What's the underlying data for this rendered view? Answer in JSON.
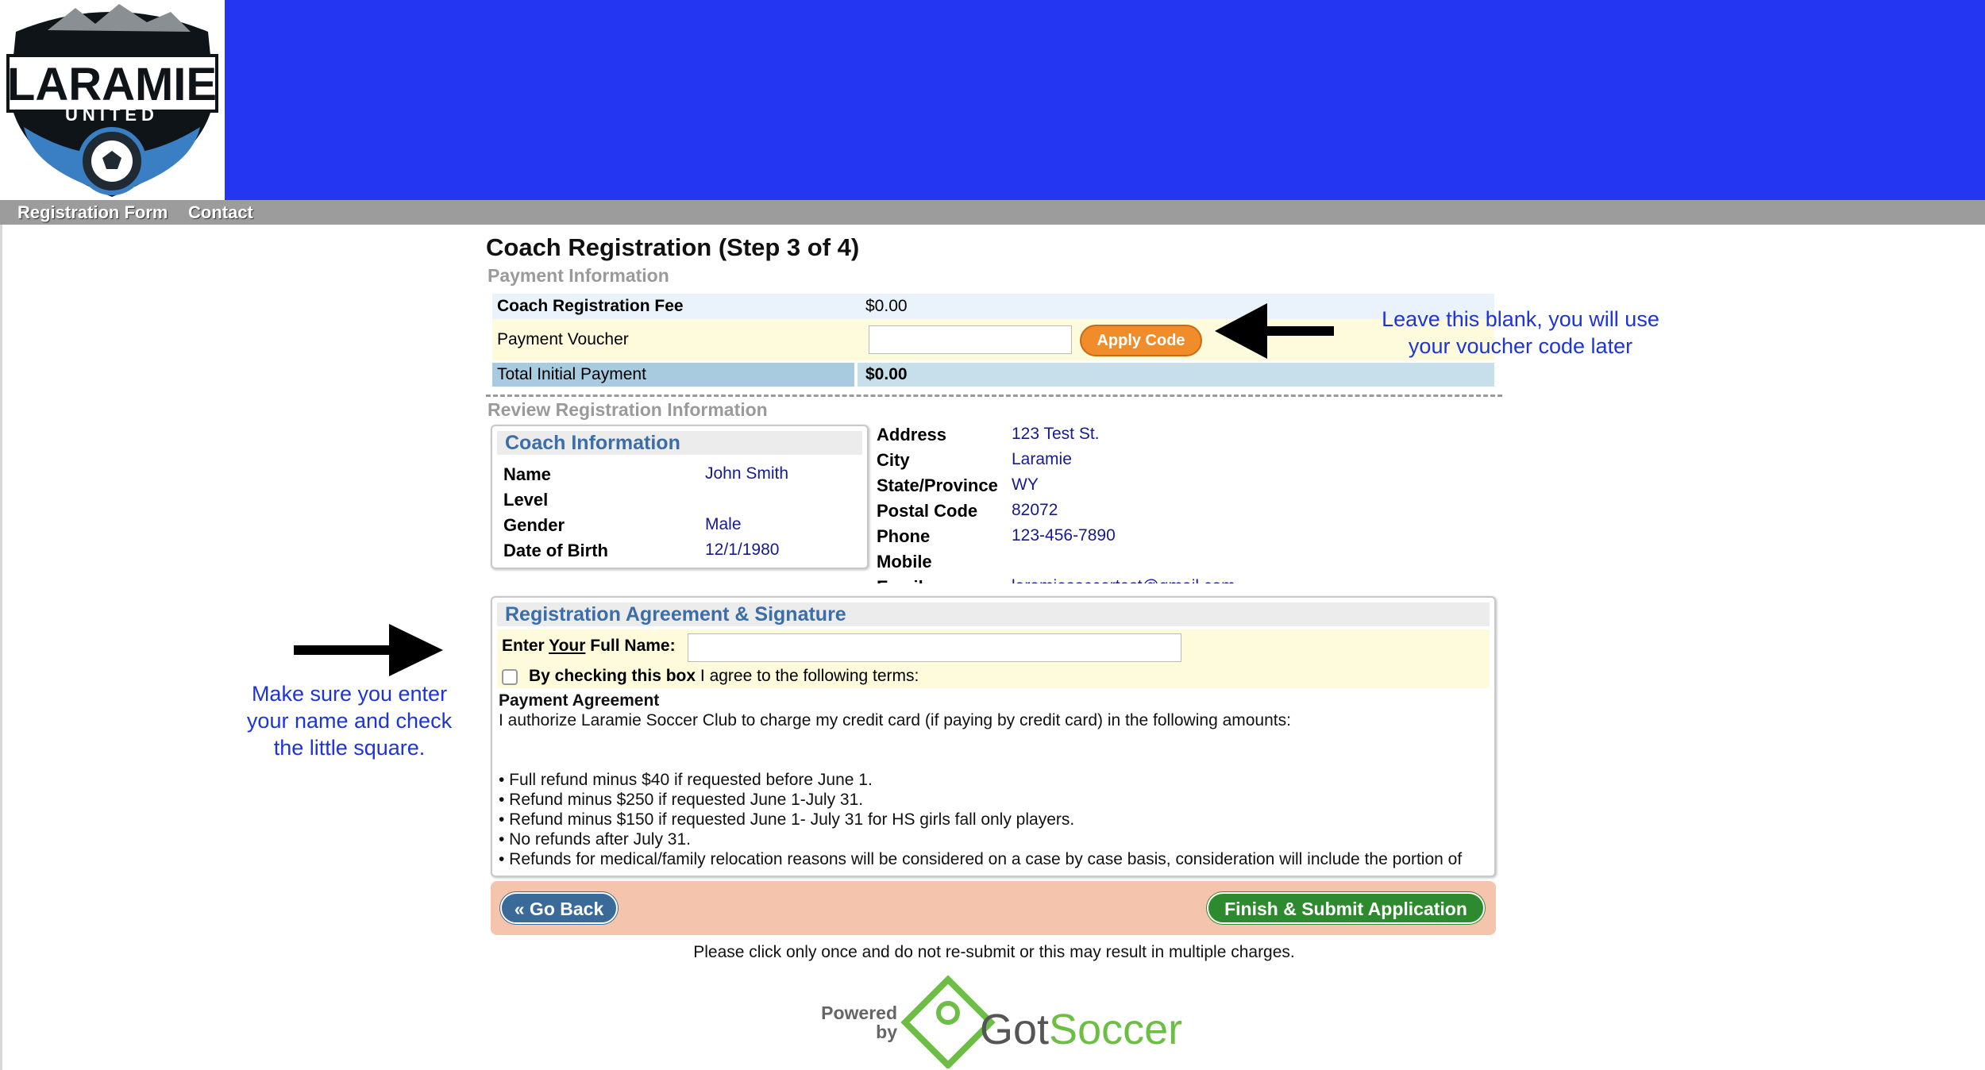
{
  "nav": {
    "items": [
      "Registration Form",
      "Contact"
    ]
  },
  "logo": {
    "line1": "LARAMIE",
    "line2": "UNITED"
  },
  "page": {
    "title": "Coach Registration (Step 3 of 4)"
  },
  "payment": {
    "section_title": "Payment Information",
    "fee_label": "Coach Registration Fee",
    "fee_value": "$0.00",
    "voucher_label": "Payment Voucher",
    "voucher_value": "",
    "apply_button": "Apply Code",
    "total_label": "Total Initial Payment",
    "total_value": "$0.00"
  },
  "review": {
    "section_title": "Review Registration Information",
    "coach_box_title": "Coach Information",
    "coach": [
      {
        "label": "Name",
        "value": "John Smith"
      },
      {
        "label": "Level",
        "value": ""
      },
      {
        "label": "Gender",
        "value": "Male"
      },
      {
        "label": "Date of Birth",
        "value": "12/1/1980"
      }
    ],
    "contact": [
      {
        "label": "Address",
        "value": "123 Test St."
      },
      {
        "label": "City",
        "value": "Laramie"
      },
      {
        "label": "State/Province",
        "value": "WY"
      },
      {
        "label": "Postal Code",
        "value": "82072"
      },
      {
        "label": "Phone",
        "value": "123-456-7890"
      },
      {
        "label": "Mobile",
        "value": ""
      },
      {
        "label": "Email",
        "value": "laramiesoccertest@gmail.com"
      }
    ]
  },
  "agreement": {
    "title": "Registration Agreement & Signature",
    "name_label_prefix": "Enter ",
    "name_label_your": "Your",
    "name_label_suffix": " Full Name:",
    "name_value": "",
    "check_bold": "By checking this box",
    "check_rest": " I agree to the following terms:",
    "payment_agreement_title": "Payment Agreement",
    "payment_agreement_text": "I authorize Laramie Soccer Club to charge my credit card (if paying by credit card) in the following amounts:",
    "terms": [
      "• Full refund minus $40 if requested before June 1.",
      "• Refund minus $250 if requested June 1-July 31.",
      "• Refund minus $150 if requested June 1- July 31 for HS girls fall only players.",
      "• No refunds after July 31.",
      "• Refunds for medical/family relocation reasons will be considered on a case by case basis, consideration will include the portion of"
    ]
  },
  "actions": {
    "go_back": "« Go Back",
    "submit": "Finish & Submit Application",
    "warning": "Please click only once and do not re-submit or this may result in multiple charges."
  },
  "footer": {
    "powered_by_line1": "Powered",
    "powered_by_line2": "by",
    "brand_got": "Got",
    "brand_soccer": "Soccer"
  },
  "annotations": {
    "voucher_note_line1": "Leave this blank, you will use",
    "voucher_note_line2": "your voucher code later",
    "name_note_line1": "Make sure you enter",
    "name_note_line2": "your name and check",
    "name_note_line3": "the little square."
  },
  "colors": {
    "header_blue": "#2436f2",
    "nav_gray": "#9c9c9c",
    "apply_orange": "#f08c2a",
    "submit_green": "#2e8a2e",
    "back_blue": "#3a6a98",
    "annotation_blue": "#1d34d8"
  }
}
